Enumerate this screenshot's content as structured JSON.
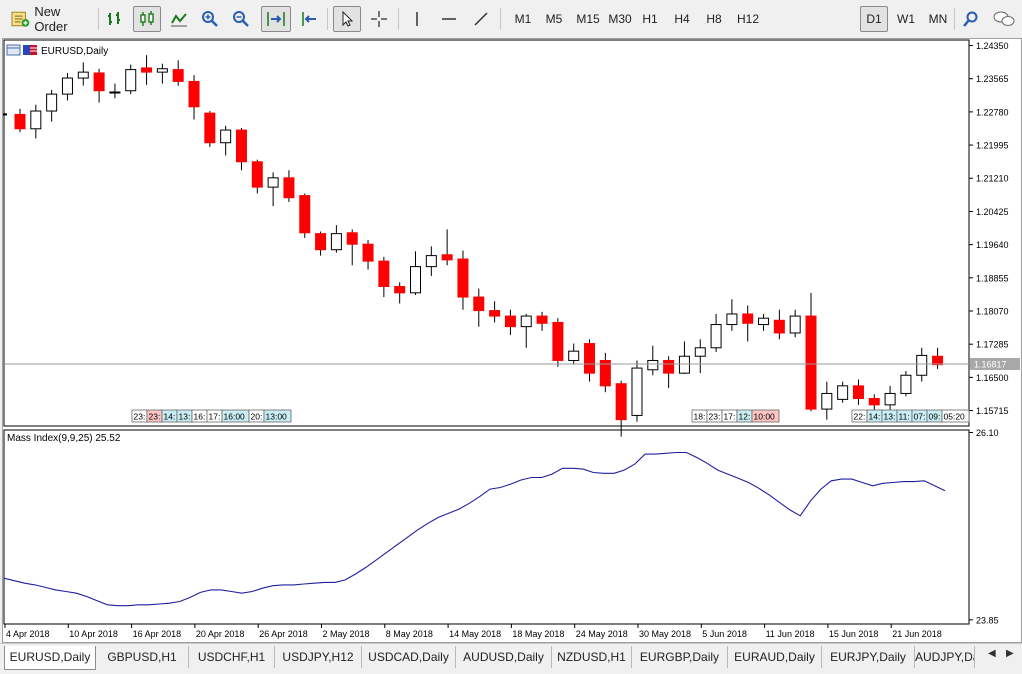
{
  "toolbar": {
    "new_order_label": "New Order",
    "timeframes": [
      "M1",
      "M5",
      "M15",
      "M30",
      "H1",
      "H4",
      "H8",
      "H12",
      "D1",
      "W1",
      "MN"
    ],
    "active_timeframe": "D1"
  },
  "chart": {
    "title": "EURUSD,Daily",
    "indicator_label": "Mass Index(9,9,25) 25.52",
    "current_price_label": "1.16817",
    "background": "#ffffff",
    "bear_color": "#ff0000",
    "bull_color": "#ffffff",
    "line_color": "#1f1f9f",
    "event_markers_a": [
      "23:",
      "23:",
      "14:",
      "13:",
      "16:",
      "17:",
      "16:00",
      "20:",
      "13:00"
    ],
    "event_markers_b": [
      "18:",
      "23:",
      "17:",
      "12:",
      "10:00"
    ],
    "event_markers_c": [
      "22:",
      "14:",
      "13:",
      "11:",
      "07:",
      "09:",
      "05:20"
    ]
  },
  "chart_data": [
    {
      "type": "candlestick",
      "title": "EURUSD,Daily",
      "ylim": [
        1.1535,
        1.2448
      ],
      "y_ticks": [
        "1.24350",
        "1.23565",
        "1.22780",
        "1.21995",
        "1.21210",
        "1.20425",
        "1.19640",
        "1.18855",
        "1.18070",
        "1.17285",
        "1.16500",
        "1.15715"
      ],
      "x_ticks": [
        "4 Apr 2018",
        "10 Apr 2018",
        "16 Apr 2018",
        "20 Apr 2018",
        "26 Apr 2018",
        "2 May 2018",
        "8 May 2018",
        "14 May 2018",
        "18 May 2018",
        "24 May 2018",
        "30 May 2018",
        "5 Jun 2018",
        "11 Jun 2018",
        "15 Jun 2018",
        "21 Jun 2018"
      ],
      "current_price": 1.16817,
      "candles": [
        {
          "o": 1.2272,
          "h": 1.2285,
          "l": 1.223,
          "c": 1.2238
        },
        {
          "o": 1.2238,
          "h": 1.2295,
          "l": 1.2215,
          "c": 1.228
        },
        {
          "o": 1.228,
          "h": 1.233,
          "l": 1.2255,
          "c": 1.232
        },
        {
          "o": 1.232,
          "h": 1.237,
          "l": 1.2305,
          "c": 1.2358
        },
        {
          "o": 1.2358,
          "h": 1.2395,
          "l": 1.234,
          "c": 1.2372
        },
        {
          "o": 1.237,
          "h": 1.238,
          "l": 1.23,
          "c": 1.2328
        },
        {
          "o": 1.2324,
          "h": 1.2345,
          "l": 1.231,
          "c": 1.2325
        },
        {
          "o": 1.2328,
          "h": 1.239,
          "l": 1.232,
          "c": 1.2378
        },
        {
          "o": 1.2382,
          "h": 1.2412,
          "l": 1.2342,
          "c": 1.2372
        },
        {
          "o": 1.2372,
          "h": 1.2392,
          "l": 1.2345,
          "c": 1.238
        },
        {
          "o": 1.2378,
          "h": 1.24,
          "l": 1.234,
          "c": 1.235
        },
        {
          "o": 1.235,
          "h": 1.2365,
          "l": 1.226,
          "c": 1.229
        },
        {
          "o": 1.2275,
          "h": 1.228,
          "l": 1.2195,
          "c": 1.2205
        },
        {
          "o": 1.2205,
          "h": 1.2245,
          "l": 1.2175,
          "c": 1.2235
        },
        {
          "o": 1.2235,
          "h": 1.224,
          "l": 1.214,
          "c": 1.216
        },
        {
          "o": 1.216,
          "h": 1.2165,
          "l": 1.2085,
          "c": 1.21
        },
        {
          "o": 1.21,
          "h": 1.2135,
          "l": 1.2055,
          "c": 1.2122
        },
        {
          "o": 1.2122,
          "h": 1.214,
          "l": 1.2065,
          "c": 1.2075
        },
        {
          "o": 1.208,
          "h": 1.2085,
          "l": 1.198,
          "c": 1.1992
        },
        {
          "o": 1.199,
          "h": 1.1995,
          "l": 1.1938,
          "c": 1.1952
        },
        {
          "o": 1.1952,
          "h": 1.201,
          "l": 1.1945,
          "c": 1.199
        },
        {
          "o": 1.1992,
          "h": 1.2,
          "l": 1.1915,
          "c": 1.1965
        },
        {
          "o": 1.1965,
          "h": 1.1975,
          "l": 1.1905,
          "c": 1.1925
        },
        {
          "o": 1.1925,
          "h": 1.1935,
          "l": 1.184,
          "c": 1.1865
        },
        {
          "o": 1.1865,
          "h": 1.1875,
          "l": 1.1825,
          "c": 1.185
        },
        {
          "o": 1.185,
          "h": 1.1948,
          "l": 1.1845,
          "c": 1.1912
        },
        {
          "o": 1.1912,
          "h": 1.196,
          "l": 1.189,
          "c": 1.1938
        },
        {
          "o": 1.194,
          "h": 1.2,
          "l": 1.1915,
          "c": 1.1928
        },
        {
          "o": 1.193,
          "h": 1.195,
          "l": 1.181,
          "c": 1.184
        },
        {
          "o": 1.184,
          "h": 1.186,
          "l": 1.177,
          "c": 1.1808
        },
        {
          "o": 1.1808,
          "h": 1.183,
          "l": 1.178,
          "c": 1.1795
        },
        {
          "o": 1.1795,
          "h": 1.181,
          "l": 1.175,
          "c": 1.177
        },
        {
          "o": 1.177,
          "h": 1.18,
          "l": 1.172,
          "c": 1.1795
        },
        {
          "o": 1.1795,
          "h": 1.1805,
          "l": 1.176,
          "c": 1.1778
        },
        {
          "o": 1.178,
          "h": 1.179,
          "l": 1.1675,
          "c": 1.169
        },
        {
          "o": 1.169,
          "h": 1.173,
          "l": 1.168,
          "c": 1.1712
        },
        {
          "o": 1.173,
          "h": 1.174,
          "l": 1.164,
          "c": 1.166
        },
        {
          "o": 1.169,
          "h": 1.1708,
          "l": 1.1615,
          "c": 1.163
        },
        {
          "o": 1.1635,
          "h": 1.1642,
          "l": 1.151,
          "c": 1.155
        },
        {
          "o": 1.156,
          "h": 1.169,
          "l": 1.1545,
          "c": 1.1672
        },
        {
          "o": 1.1668,
          "h": 1.1725,
          "l": 1.1655,
          "c": 1.169
        },
        {
          "o": 1.169,
          "h": 1.17,
          "l": 1.1625,
          "c": 1.166
        },
        {
          "o": 1.166,
          "h": 1.1735,
          "l": 1.1658,
          "c": 1.17
        },
        {
          "o": 1.17,
          "h": 1.174,
          "l": 1.166,
          "c": 1.172
        },
        {
          "o": 1.172,
          "h": 1.18,
          "l": 1.171,
          "c": 1.1775
        },
        {
          "o": 1.1775,
          "h": 1.1835,
          "l": 1.176,
          "c": 1.18
        },
        {
          "o": 1.18,
          "h": 1.182,
          "l": 1.1735,
          "c": 1.1778
        },
        {
          "o": 1.1775,
          "h": 1.18,
          "l": 1.176,
          "c": 1.179
        },
        {
          "o": 1.1785,
          "h": 1.181,
          "l": 1.174,
          "c": 1.1755
        },
        {
          "o": 1.1755,
          "h": 1.181,
          "l": 1.1745,
          "c": 1.1795
        },
        {
          "o": 1.1795,
          "h": 1.185,
          "l": 1.157,
          "c": 1.1575
        },
        {
          "o": 1.1575,
          "h": 1.164,
          "l": 1.155,
          "c": 1.1612
        },
        {
          "o": 1.1598,
          "h": 1.164,
          "l": 1.159,
          "c": 1.163
        },
        {
          "o": 1.163,
          "h": 1.1645,
          "l": 1.1585,
          "c": 1.16
        },
        {
          "o": 1.16,
          "h": 1.161,
          "l": 1.155,
          "c": 1.1585
        },
        {
          "o": 1.1585,
          "h": 1.163,
          "l": 1.157,
          "c": 1.1612
        },
        {
          "o": 1.1612,
          "h": 1.1665,
          "l": 1.1605,
          "c": 1.1655
        },
        {
          "o": 1.1655,
          "h": 1.172,
          "l": 1.164,
          "c": 1.1702
        },
        {
          "o": 1.17,
          "h": 1.172,
          "l": 1.167,
          "c": 1.168
        }
      ]
    },
    {
      "type": "line",
      "title": "Mass Index(9,9,25) 25.52",
      "ylim": [
        23.8,
        26.13
      ],
      "y_ticks": [
        "26.10",
        "23.85"
      ],
      "values": [
        24.35,
        24.32,
        24.29,
        24.27,
        24.24,
        24.21,
        24.19,
        24.17,
        24.13,
        24.08,
        24.03,
        24.02,
        24.02,
        24.03,
        24.03,
        24.04,
        24.05,
        24.07,
        24.12,
        24.18,
        24.21,
        24.21,
        24.19,
        24.17,
        24.19,
        24.23,
        24.26,
        24.27,
        24.27,
        24.28,
        24.29,
        24.3,
        24.3,
        24.33,
        24.4,
        24.48,
        24.57,
        24.66,
        24.75,
        24.84,
        24.93,
        25.01,
        25.08,
        25.13,
        25.18,
        25.25,
        25.33,
        25.42,
        25.44,
        25.48,
        25.53,
        25.56,
        25.56,
        25.6,
        25.67,
        25.67,
        25.66,
        25.62,
        25.61,
        25.61,
        25.65,
        25.72,
        25.84,
        25.84,
        25.85,
        25.86,
        25.86,
        25.8,
        25.73,
        25.65,
        25.6,
        25.55,
        25.5,
        25.43,
        25.35,
        25.26,
        25.17,
        25.1,
        25.28,
        25.42,
        25.52,
        25.54,
        25.54,
        25.5,
        25.46,
        25.49,
        25.5,
        25.51,
        25.51,
        25.52,
        25.46,
        25.4
      ]
    }
  ],
  "tabs": [
    "EURUSD,Daily",
    "GBPUSD,H1",
    "USDCHF,H1",
    "USDJPY,H12",
    "USDCAD,Daily",
    "AUDUSD,Daily",
    "NZDUSD,H1",
    "EURGBP,Daily",
    "EURAUD,Daily",
    "EURJPY,Daily",
    "AUDJPY,Daily"
  ],
  "active_tab": "EURUSD,Daily"
}
